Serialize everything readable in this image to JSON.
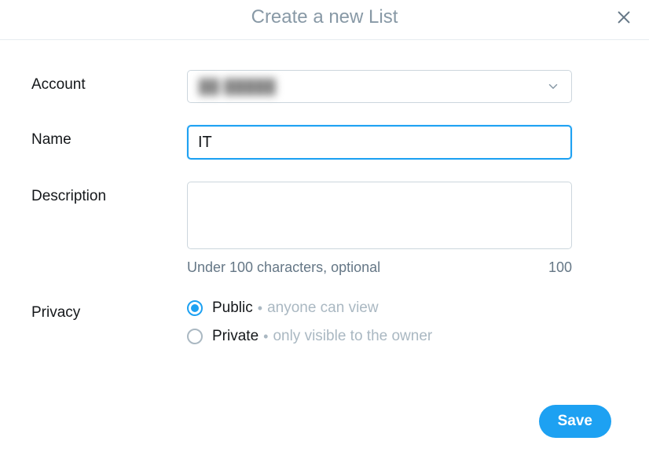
{
  "header": {
    "title": "Create a new List"
  },
  "form": {
    "account": {
      "label": "Account",
      "value": "██ █████"
    },
    "name": {
      "label": "Name",
      "value": "IT"
    },
    "description": {
      "label": "Description",
      "value": "",
      "hint": "Under 100 characters, optional",
      "counter": "100"
    },
    "privacy": {
      "label": "Privacy",
      "options": {
        "public": {
          "label": "Public",
          "desc": "anyone can view",
          "selected": true
        },
        "private": {
          "label": "Private",
          "desc": "only visible to the owner",
          "selected": false
        }
      }
    }
  },
  "footer": {
    "save_label": "Save"
  }
}
